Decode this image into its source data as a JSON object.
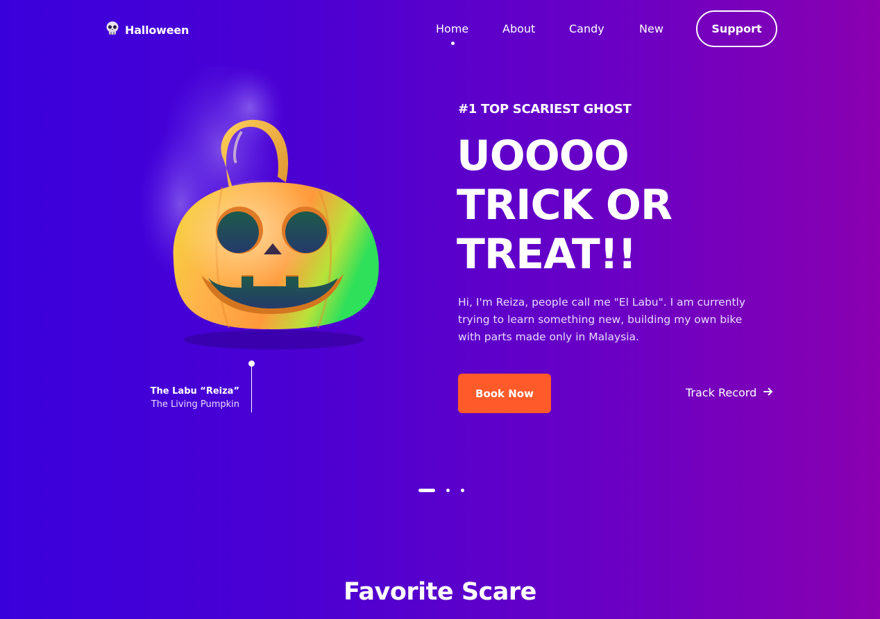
{
  "brand": {
    "name": "Halloween",
    "icon": "skull-icon"
  },
  "nav": {
    "items": [
      {
        "label": "Home",
        "active": true
      },
      {
        "label": "About",
        "active": false
      },
      {
        "label": "Candy",
        "active": false
      },
      {
        "label": "New",
        "active": false
      }
    ],
    "support_label": "Support"
  },
  "hero": {
    "eyebrow": "#1 TOP SCARIEST GHOST",
    "headline_lines": [
      "UOOOO",
      "TRICK OR",
      "TREAT!!"
    ],
    "description": "Hi, I'm Reiza, people call me \"El Labu\". I am currently trying to learn something new, building my own bike with parts made only in Malaysia.",
    "book_label": "Book Now",
    "track_label": "Track Record",
    "track_icon": "arrow-right-icon"
  },
  "character": {
    "name": "The Labu “Reiza”",
    "subtitle": "The Living Pumpkin",
    "image_icon": "jack-o-lantern-icon"
  },
  "pager": {
    "count": 3,
    "active_index": 0
  },
  "section": {
    "title": "Favorite Scare"
  },
  "colors": {
    "background_start": "#3a00dc",
    "background_end": "#8a00b0",
    "accent": "#ff5a2a",
    "text": "#ffffff"
  }
}
